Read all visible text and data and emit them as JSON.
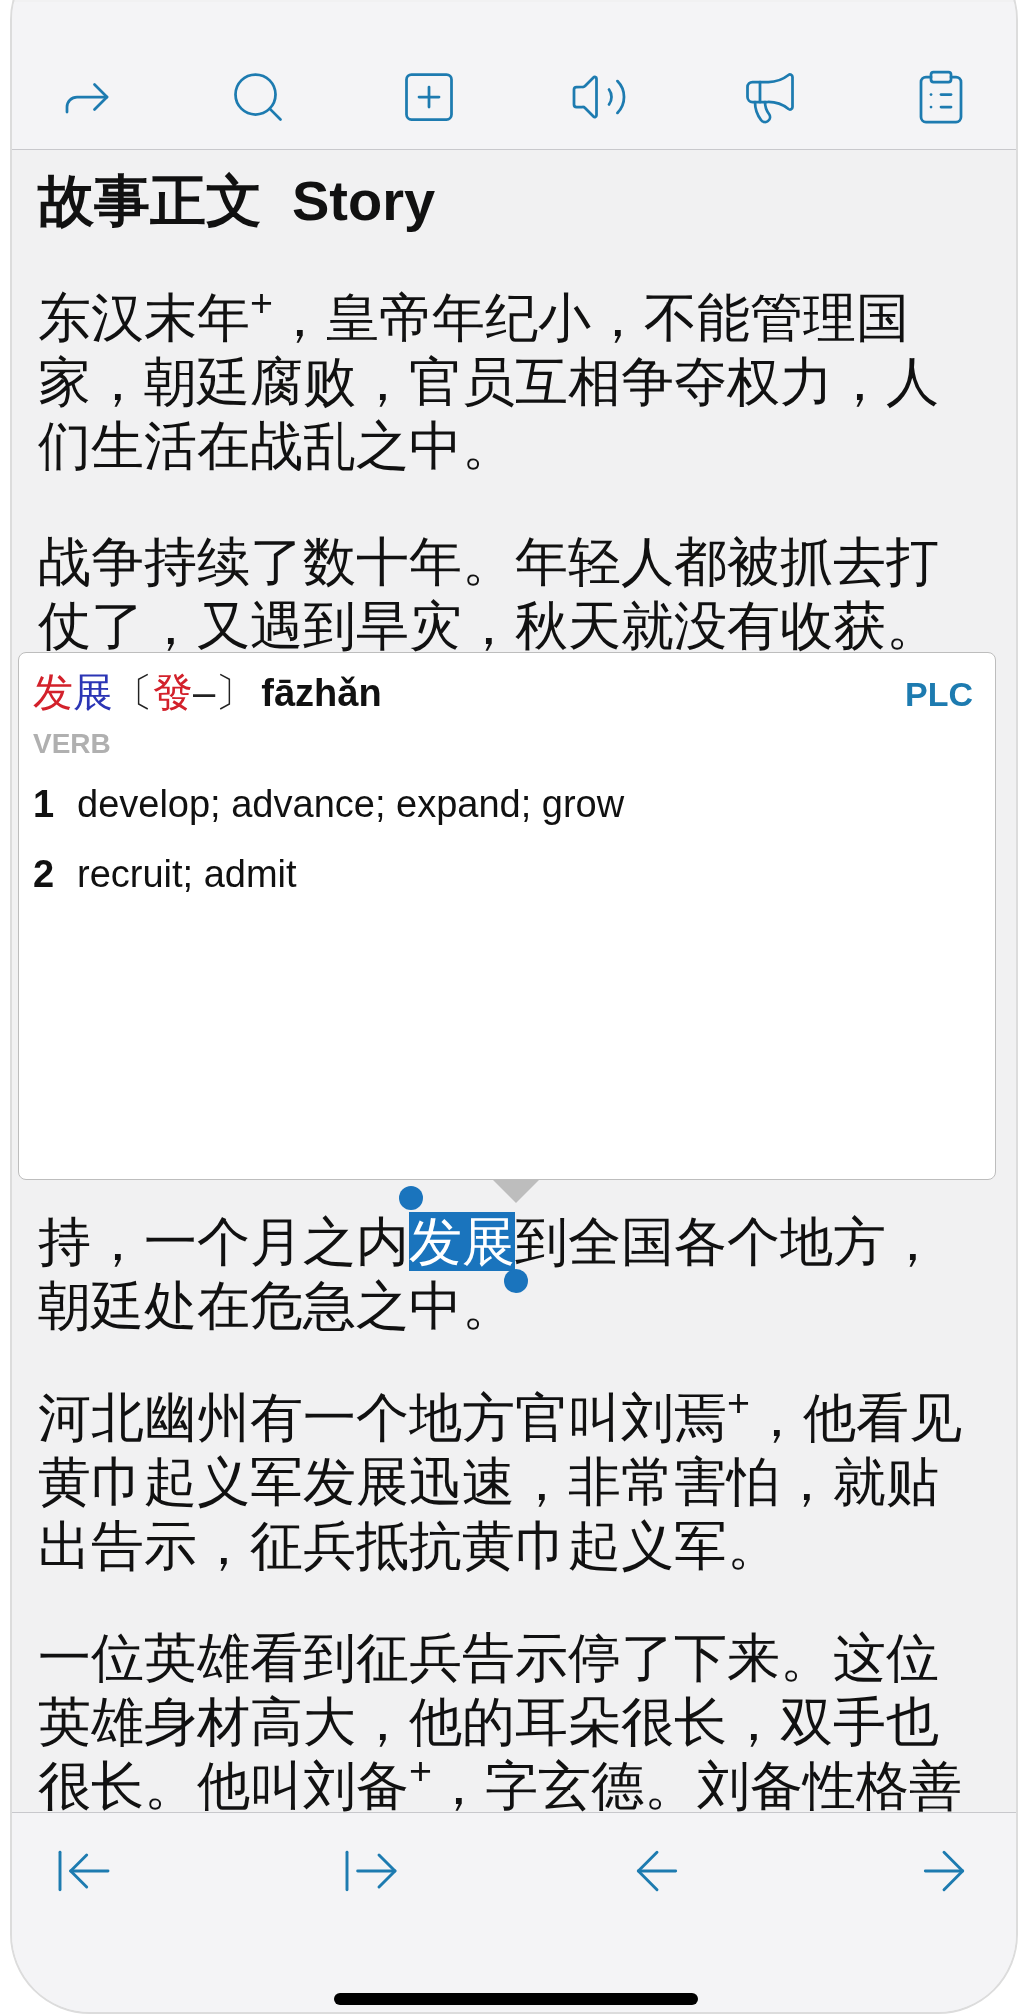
{
  "story": {
    "title": "故事正文",
    "title_en": "Story",
    "paragraphs": [
      {
        "segments": [
          {
            "text": "东汉末年$^{+}$，皇帝年纪小，不能管理国家，朝廷腐败，官员互相争夺权力，人们生活在战乱之中。",
            "selected": false
          }
        ]
      },
      {
        "segments": [
          {
            "text": "战争持续了数十年。年轻人都被抓去打仗了，又遇到旱灾，秋天就没有收获。",
            "selected": false
          }
        ]
      }
    ],
    "paragraphs_after_popup": [
      {
        "segments": [
          {
            "text": "持，一个月之内",
            "selected": false
          },
          {
            "text": "发展",
            "selected": true
          },
          {
            "text": "到全国各个地方，朝廷处在危急之中。",
            "selected": false
          }
        ]
      },
      {
        "segments": [
          {
            "text": "河北幽州有一个地方官叫刘焉$^{+}$，他看见黄巾起义军发展迅速，非常害怕，就贴出告示，征兵抵抗黄巾起义军。",
            "selected": false
          }
        ]
      },
      {
        "segments": [
          {
            "text": "一位英雄看到征兵告示停了下来。这位英雄身材高大，他的耳朵很长，双手也很长。他叫刘备$^{+}$，字玄德。刘备性格善",
            "selected": false
          }
        ]
      }
    ]
  },
  "popup": {
    "headword": [
      {
        "text": "发",
        "color": "#d3212b"
      },
      {
        "text": "展",
        "color": "#2b35b5"
      }
    ],
    "traditional": {
      "open": "〔",
      "parts": [
        {
          "text": "發",
          "color": "#d3212b"
        },
        {
          "text": "–",
          "color": "#222222"
        }
      ],
      "close": "〕"
    },
    "pinyin": "fāzhǎn",
    "source": "PLC",
    "part_of_speech": "VERB",
    "definitions": [
      {
        "number": "1",
        "text": "develop; advance; expand; grow"
      },
      {
        "number": "2",
        "text": "recruit; admit"
      }
    ]
  }
}
